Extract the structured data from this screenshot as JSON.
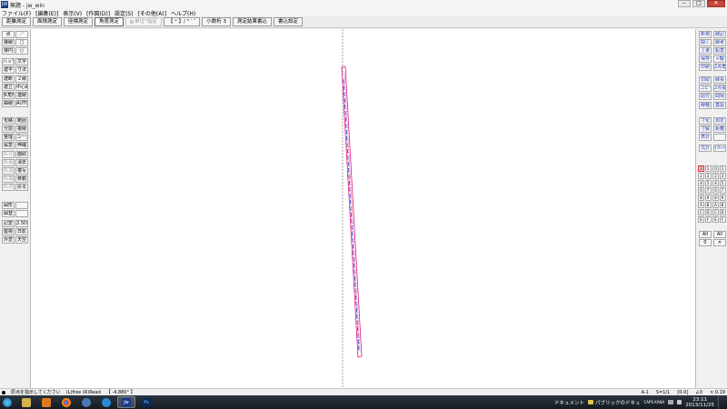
{
  "window": {
    "title": "無題 - jw_win",
    "icon": "JW",
    "controls": [
      "‒",
      "□",
      "✕"
    ]
  },
  "menu": [
    "ファイル(F)",
    "[編集(E)]",
    "表示(V)",
    "[作図(D)]",
    "設定(S)",
    "[その他(A)]",
    "ヘルプ(H)"
  ],
  "toolbar": {
    "buttons": [
      {
        "label": "距離測定",
        "state": "normal"
      },
      {
        "label": "面積測定",
        "state": "normal"
      },
      {
        "label": "座標測定",
        "state": "normal"
      },
      {
        "label": "角度測定",
        "state": "active"
      },
      {
        "label": "単位°指定",
        "state": "disabled"
      },
      {
        "label": "【 ° 】/ ° ′ ″",
        "state": "normal"
      },
      {
        "label": "小数桁 3",
        "state": "normal"
      },
      {
        "label": "測定結果書込",
        "state": "normal"
      },
      {
        "label": "書込設定",
        "state": "normal"
      }
    ]
  },
  "left_tools": [
    [
      "点",
      "／"
    ],
    [
      "接線",
      "□"
    ],
    [
      "接円",
      "○"
    ],
    [
      "ハッチ",
      "文字"
    ],
    [
      "建平",
      "寸法"
    ],
    [
      "建断",
      "２線"
    ],
    [
      "建立",
      "中心線"
    ],
    [
      "多角形",
      "連線"
    ],
    [
      "曲線",
      "AUTO"
    ],
    [
      "包絡",
      "範囲"
    ],
    [
      "分割",
      "複線"
    ],
    [
      "整理",
      "コーナー"
    ],
    [
      "属変",
      "伸縮"
    ],
    [
      "BL化",
      "面取"
    ],
    [
      "BL解",
      "消去"
    ],
    [
      "BL属",
      "複写"
    ],
    [
      "BL編",
      "移動"
    ],
    [
      "BL終",
      "戻る"
    ],
    [
      "図形",
      ""
    ],
    [
      "図登",
      ""
    ],
    [
      "記変",
      "2.5D"
    ],
    [
      "座標",
      "日影"
    ],
    [
      "外変",
      "天空"
    ]
  ],
  "right_tools": [
    [
      "新規",
      "線記"
    ],
    [
      "開く",
      "線考"
    ],
    [
      "上書",
      "鉛直"
    ],
    [
      "保存",
      "×軸"
    ],
    [
      "印刷",
      "2点角"
    ],
    [
      "切取",
      "線長"
    ],
    [
      "コピー",
      "2点長"
    ],
    [
      "貼付",
      "間隔"
    ],
    [
      "線種",
      "基設"
    ],
    [
      "寸化",
      "測定"
    ],
    [
      "寸解",
      "距離"
    ],
    [
      "表計",
      ""
    ],
    [
      "式計",
      "ｵﾌｾｯﾄ"
    ]
  ],
  "right_layers": {
    "group_digits": [
      "0",
      "1",
      "2",
      "3",
      "4",
      "5",
      "6",
      "7",
      "8",
      "9",
      "A",
      "B",
      "C",
      "D",
      "E",
      "F"
    ],
    "all_label": "All",
    "group_indicator": "0",
    "layer_indicator": "✕"
  },
  "status": {
    "message": "原点を指示してください",
    "mode": "(L)free (R)Read",
    "angle": "【 -4.880° 】",
    "paper": "A-1",
    "scale": "S=1/1",
    "layer": "[0-0]",
    "angle_right": "∠0",
    "zoom": "× 0.19"
  },
  "taskbar": {
    "apps": [
      "explorer",
      "media",
      "chrome",
      "ie-alt",
      "ie",
      "jwcad",
      "photoshop"
    ],
    "ps_label": "Ps",
    "jw_label": "Jw",
    "tray_text_1": "ドキュメント",
    "tray_text_2": "パブリックのドキュ",
    "time": "23:11",
    "date": "2013/11/25",
    "ime": "CAPS KANA"
  },
  "colors": {
    "line_magenta": "#e0197e",
    "line_blue": "#3d4fd6",
    "aux_line": "#888888",
    "taskbar_bg": "#1b2129"
  }
}
